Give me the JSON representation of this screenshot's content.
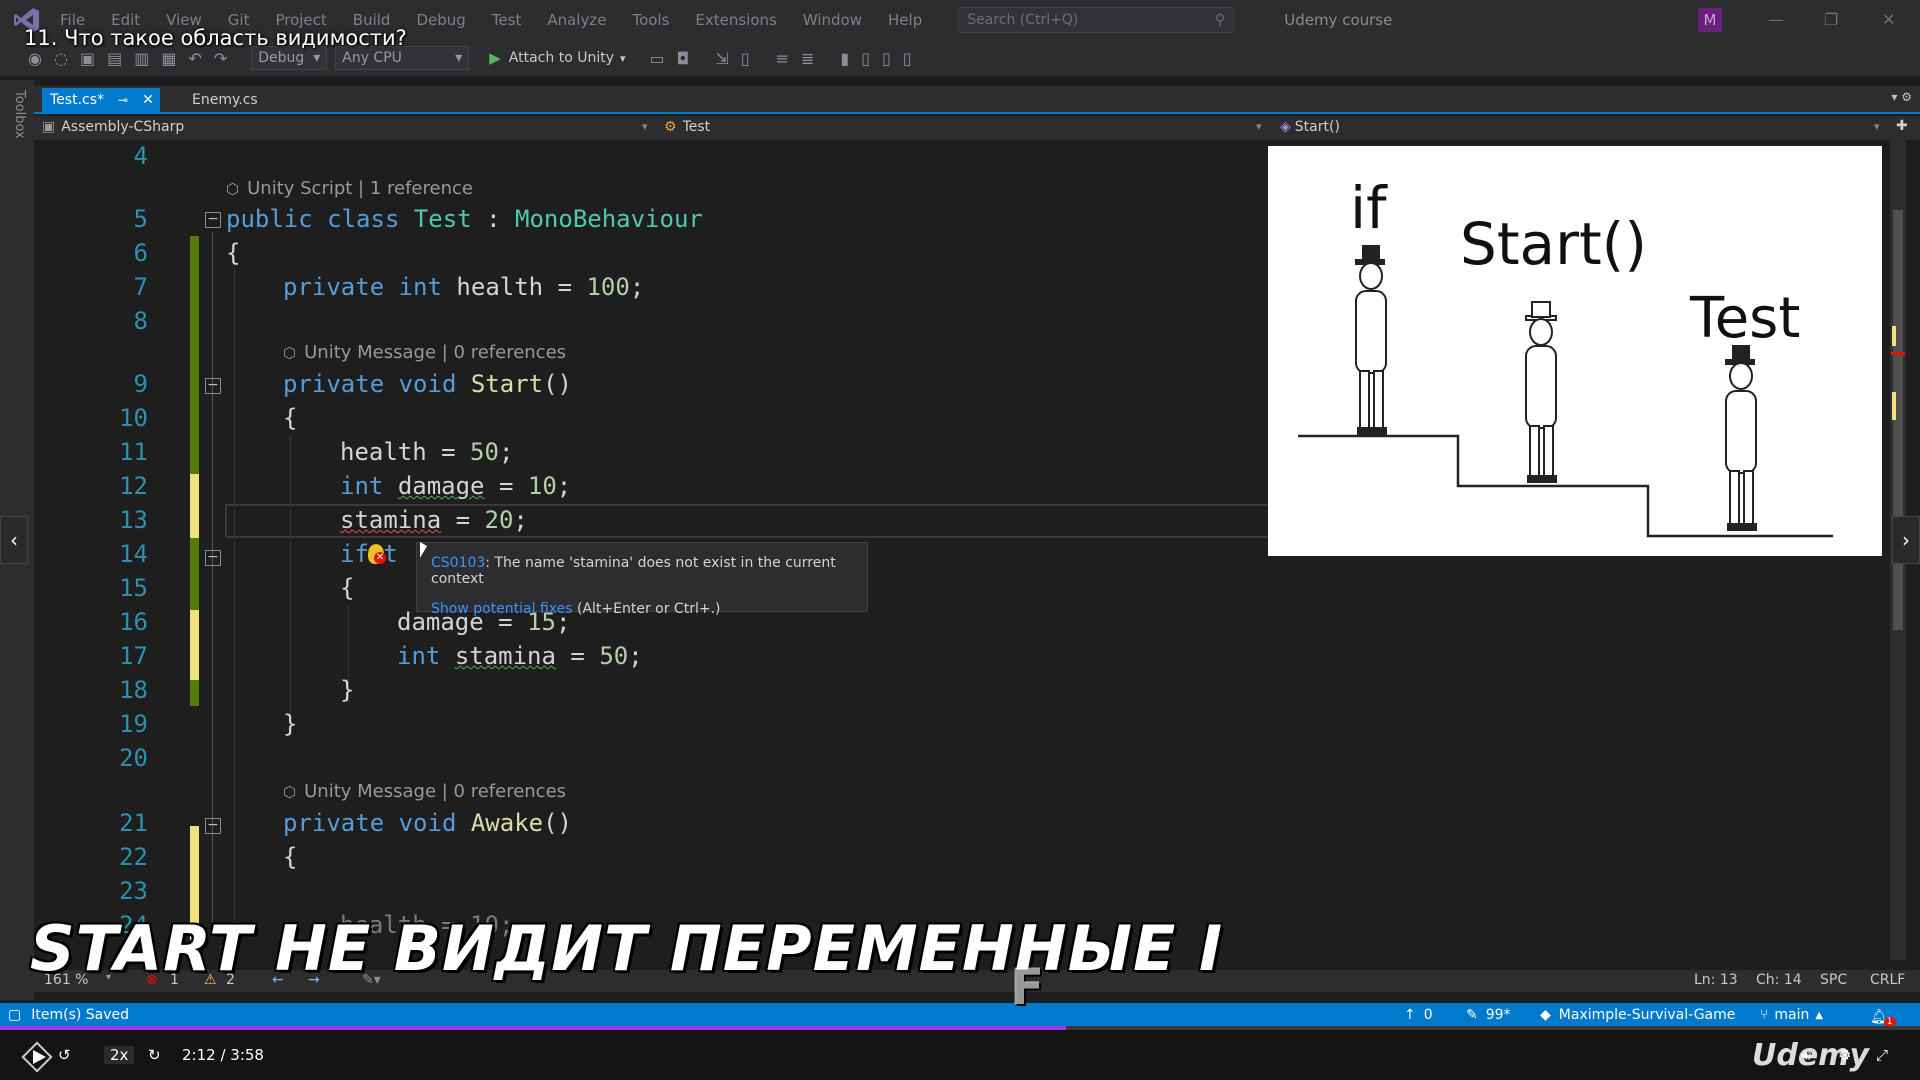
{
  "menubar": {
    "items": [
      "File",
      "Edit",
      "View",
      "Git",
      "Project",
      "Build",
      "Debug",
      "Test",
      "Analyze",
      "Tools",
      "Extensions",
      "Window",
      "Help"
    ],
    "search_placeholder": "Search (Ctrl+Q)",
    "window_title": "Udemy course",
    "account_initial": "M"
  },
  "video_title": "11. Что такое область видимости?",
  "toolbar": {
    "config": "Debug",
    "platform": "Any CPU",
    "attach_label": "Attach to Unity"
  },
  "toolbox_label": "Toolbox",
  "tabs": [
    {
      "label": "Test.cs*",
      "active": true
    },
    {
      "label": "Enemy.cs",
      "active": false
    }
  ],
  "navbar": {
    "project": "Assembly-CSharp",
    "class": "Test",
    "member": "Start()"
  },
  "codelens": {
    "class_lens": "Unity Script | 1 reference",
    "start_lens": "Unity Message | 0 references",
    "awake_lens": "Unity Message | 0 references"
  },
  "line_numbers": [
    "4",
    "5",
    "6",
    "7",
    "8",
    "9",
    "10",
    "11",
    "12",
    "13",
    "14",
    "15",
    "16",
    "17",
    "18",
    "19",
    "20",
    "21",
    "22",
    "23",
    "24"
  ],
  "code": {
    "l5": [
      "public",
      "class",
      "Test",
      ":",
      "MonoBehaviour"
    ],
    "l6": "{",
    "l7": [
      "private",
      "int",
      "health = ",
      "100",
      ";"
    ],
    "l9": [
      "private",
      "void",
      "Start",
      "()"
    ],
    "l10": "{",
    "l11": [
      "health = ",
      "50",
      ";"
    ],
    "l12": [
      "int",
      "damage",
      " = ",
      "10",
      ";"
    ],
    "l13": [
      "stamina",
      " = ",
      "20",
      ";"
    ],
    "l14": "if t",
    "l15": "{",
    "l16": [
      "damage",
      " = ",
      "15",
      ";"
    ],
    "l17": [
      "int",
      "stamina",
      " = ",
      "50",
      ";"
    ],
    "l18": "}",
    "l19": "}",
    "l21": [
      "private",
      "void",
      "Awake",
      "()"
    ],
    "l22": "{",
    "l24": "health = 10;"
  },
  "tooltip": {
    "error_code": "CS0103",
    "message": ": The name 'stamina' does not exist in the current context",
    "fix_link": "Show potential fixes",
    "fix_hint": " (Alt+Enter or Ctrl+.)"
  },
  "overlay": {
    "label_if": "if",
    "label_start": "Start()",
    "label_test": "Test"
  },
  "editor_status": {
    "zoom": "161 %",
    "errors": "1",
    "warnings": "2",
    "line": "Ln: 13",
    "column": "Ch: 14",
    "whitespace": "SPC",
    "line_ending": "CRLF"
  },
  "statusbar": {
    "message": "Item(s) Saved",
    "push_count": "0",
    "pencil_count": "99*",
    "repo": "Maximple-Survival-Game",
    "branch": "main",
    "notifications": "1"
  },
  "caption": "START НЕ ВИДИТ ПЕРЕМЕННЫЕ I",
  "caption_extra": "F",
  "player": {
    "speed": "2x",
    "time": "2:12 / 3:58",
    "progress": 0.555,
    "logo": "Udemy"
  },
  "colors": {
    "accent": "#007acc",
    "progress": "#a435f0",
    "keyword": "#569cd6",
    "type": "#4ec9b0",
    "method": "#dcdcaa",
    "number": "#b5cea8",
    "line_number": "#2b91af"
  }
}
